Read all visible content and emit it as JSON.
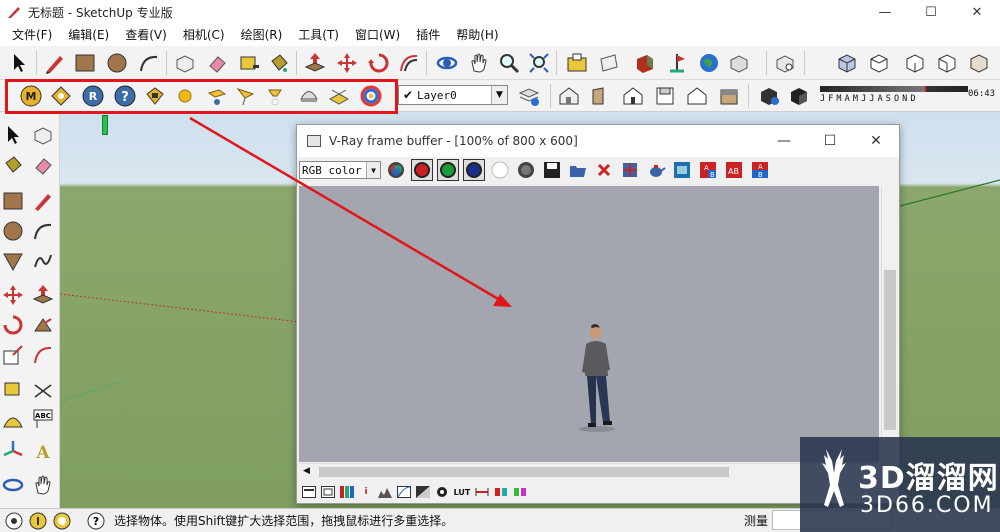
{
  "window": {
    "title": "无标题 - SketchUp 专业版",
    "controls": [
      "—",
      "☐",
      "✕"
    ]
  },
  "menubar": {
    "items": [
      "文件(F)",
      "编辑(E)",
      "查看(V)",
      "相机(C)",
      "绘图(R)",
      "工具(T)",
      "窗口(W)",
      "插件",
      "帮助(H)"
    ]
  },
  "layers": {
    "current": "Layer0",
    "check": "✔"
  },
  "shadows": {
    "months": "JFMAMJJASOND",
    "time": "06:43"
  },
  "vray": {
    "title": "V-Ray frame buffer - [100% of 800 x 600]",
    "channel": "RGB color",
    "controls": [
      "—",
      "☐",
      "✕"
    ],
    "bottom_icons": [
      "i",
      "LUT"
    ]
  },
  "statusbar": {
    "hint": "选择物体。使用Shift键扩大选择范围，拖拽鼠标进行多重选择。",
    "measure_label": "测量"
  },
  "watermark": {
    "cn": "3D溜溜网",
    "en": "3D66.COM"
  },
  "colors": {
    "highlight": "#e1161b",
    "arrow": "#e1161b",
    "render_bg": "#a3a6af"
  }
}
